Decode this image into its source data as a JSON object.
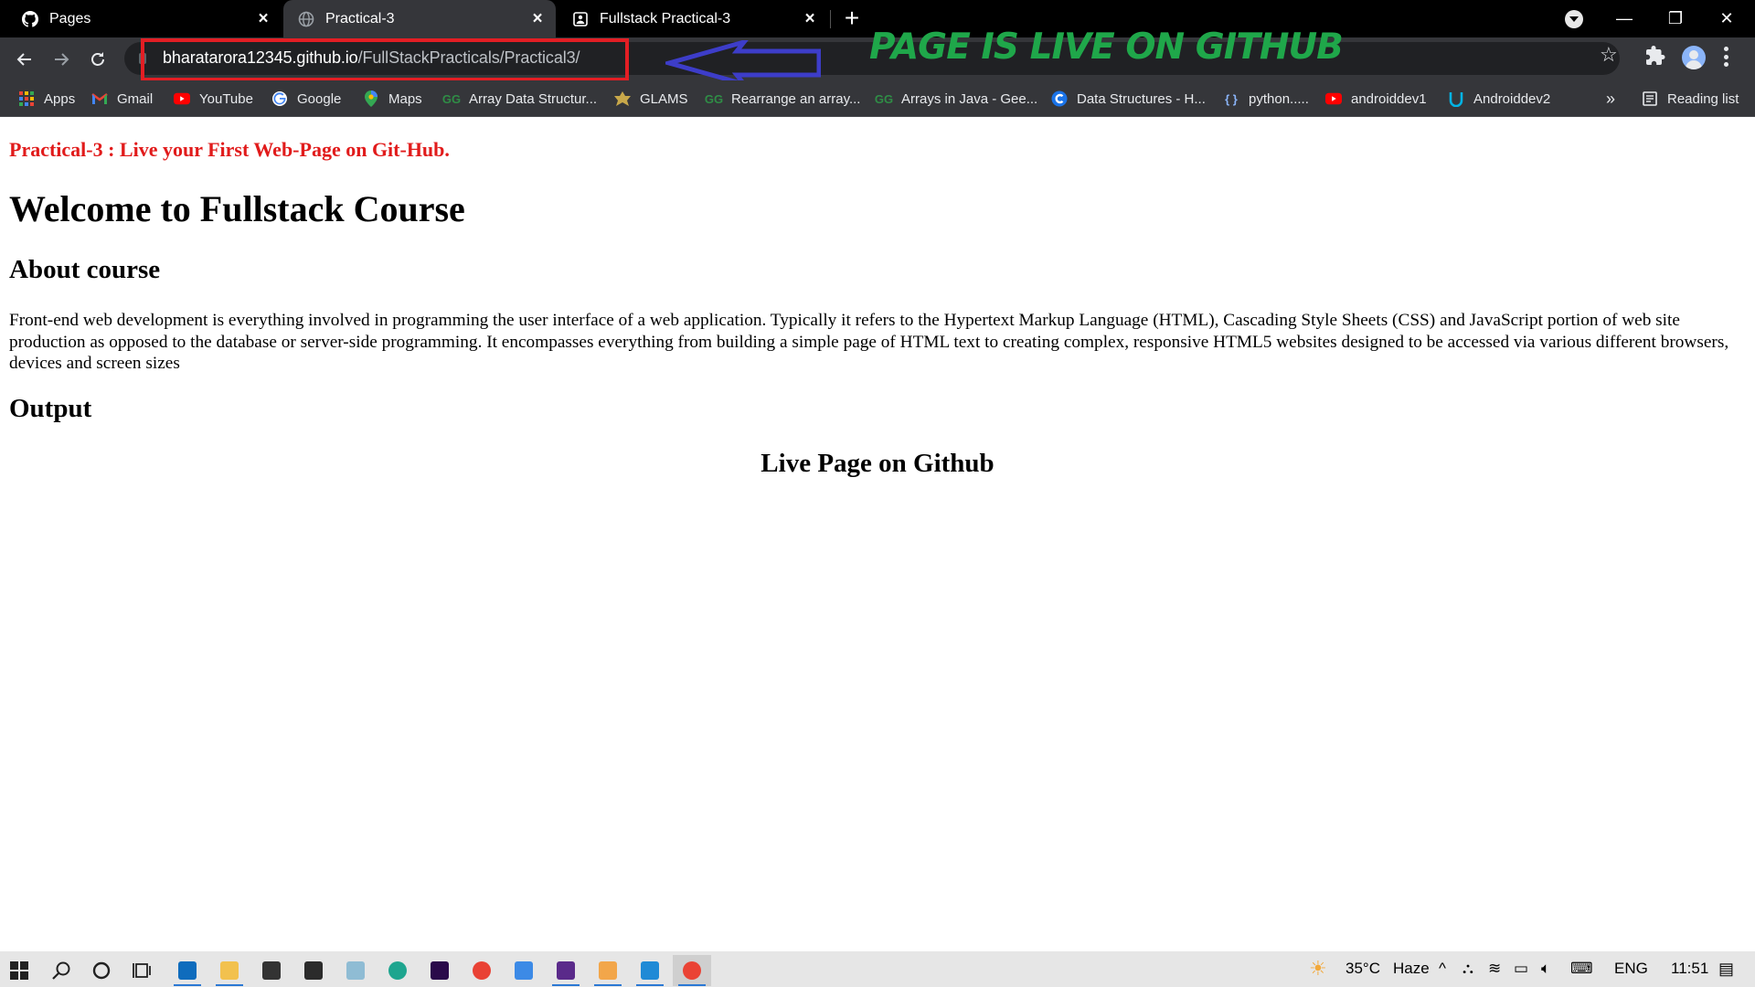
{
  "browser": {
    "tabs": [
      {
        "title": "Pages",
        "icon": "github-icon",
        "active": false
      },
      {
        "title": "Practical-3",
        "icon": "globe-icon",
        "active": true
      },
      {
        "title": "Fullstack Practical-3",
        "icon": "page-icon",
        "active": false
      }
    ],
    "new_tab_label": "+",
    "window_controls": {
      "minimize": "—",
      "restore": "❐",
      "close": "✕"
    }
  },
  "toolbar": {
    "url_host": "bharatarora12345.github.io",
    "url_path": "/FullStackPracticals/Practical3/"
  },
  "annotation": {
    "text": "PAGE IS LIVE ON GITHUB",
    "text_color": "#1fa74a",
    "highlight_color": "#e31e24",
    "arrow_color": "#3d3dc9"
  },
  "bookmarks": {
    "items": [
      {
        "label": "Apps",
        "icon": "apps-grid-icon"
      },
      {
        "label": "Gmail",
        "icon": "gmail-icon"
      },
      {
        "label": "YouTube",
        "icon": "youtube-icon"
      },
      {
        "label": "Google",
        "icon": "google-icon"
      },
      {
        "label": "Maps",
        "icon": "maps-icon"
      },
      {
        "label": "Array Data Structur...",
        "icon": "geeksforgeeks-icon"
      },
      {
        "label": "GLAMS",
        "icon": "glams-icon"
      },
      {
        "label": "Rearrange an array...",
        "icon": "geeksforgeeks-icon"
      },
      {
        "label": "Arrays in Java - Gee...",
        "icon": "geeksforgeeks-icon"
      },
      {
        "label": "Data Structures - H...",
        "icon": "codechef-icon"
      },
      {
        "label": "python.....",
        "icon": "braces-icon"
      },
      {
        "label": "androiddev1",
        "icon": "youtube-icon"
      },
      {
        "label": "Androiddev2",
        "icon": "udacity-icon"
      }
    ],
    "more": "»",
    "reading_list": "Reading list"
  },
  "page": {
    "practical_title": "Practical-3 : Live your First Web-Page on Git-Hub.",
    "heading": "Welcome to Fullstack Course",
    "about_heading": "About course",
    "about_text": "Front-end web development is everything involved in programming the user interface of a web application. Typically it refers to the Hypertext Markup Language (HTML), Cascading Style Sheets (CSS) and JavaScript portion of web site production as opposed to the database or server-side programming. It encompasses everything from building a simple page of HTML text to creating complex, responsive HTML5 websites designed to be accessed via various different browsers, devices and screen sizes",
    "output_heading": "Output",
    "live_heading": "Live Page on Github"
  },
  "taskbar": {
    "weather_temp": "35°C",
    "weather_desc": "Haze",
    "language": "ENG",
    "time": "11:51"
  }
}
